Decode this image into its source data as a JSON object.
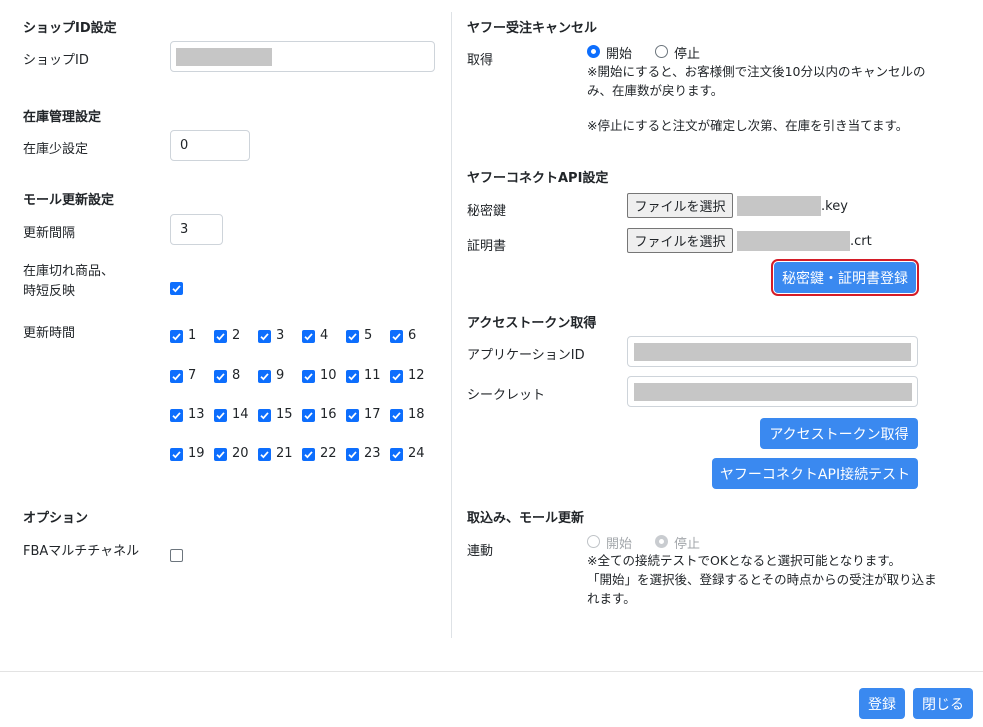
{
  "shop_id": {
    "heading": "ショップID設定",
    "label": "ショップID"
  },
  "inventory": {
    "heading": "在庫管理設定",
    "label": "在庫少設定",
    "value": "0"
  },
  "mall_update": {
    "heading": "モール更新設定",
    "interval_label": "更新間隔",
    "interval_value": "3",
    "oos_label_line1": "在庫切れ商品、",
    "oos_label_line2": "時短反映",
    "oos_checked": true,
    "hours_label": "更新時間",
    "hours": [
      "1",
      "2",
      "3",
      "4",
      "5",
      "6",
      "7",
      "8",
      "9",
      "10",
      "11",
      "12",
      "13",
      "14",
      "15",
      "16",
      "17",
      "18",
      "19",
      "20",
      "21",
      "22",
      "23",
      "24"
    ]
  },
  "option": {
    "heading": "オプション",
    "fba_label": "FBAマルチチャネル",
    "fba_checked": false
  },
  "yahoo_cancel": {
    "heading": "ヤフー受注キャンセル",
    "label": "取得",
    "start": "開始",
    "stop": "停止",
    "selected": "start",
    "note1": "※開始にすると、お客様側で注文後10分以内のキャンセルの",
    "note2": "み、在庫数が戻ります。",
    "note3": "※停止にすると注文が確定し次第、在庫を引き当てます。"
  },
  "yahoo_connect": {
    "heading": "ヤフーコネクトAPI設定",
    "secret_key_label": "秘密鍵",
    "cert_label": "証明書",
    "file_button": "ファイルを選択",
    "key_ext": ".key",
    "crt_ext": ".crt",
    "register_button": "秘密鍵・証明書登録"
  },
  "access_token": {
    "heading": "アクセストークン取得",
    "app_id_label": "アプリケーションID",
    "secret_label": "シークレット",
    "get_button": "アクセストークン取得",
    "test_button": "ヤフーコネクトAPI接続テスト"
  },
  "import": {
    "heading": "取込み、モール更新",
    "label": "連動",
    "start": "開始",
    "stop": "停止",
    "note1": "※全ての接続テストでOKとなると選択可能となります。",
    "note2": "「開始」を選択後、登録するとその時点からの受注が取り込ま",
    "note3": "れます。"
  },
  "footer": {
    "save_button": "登録",
    "close_button": "閉じる"
  },
  "colors": {
    "primary": "#3a89f0",
    "checkbox": "#0d6efd",
    "highlight": "#d41c27"
  }
}
